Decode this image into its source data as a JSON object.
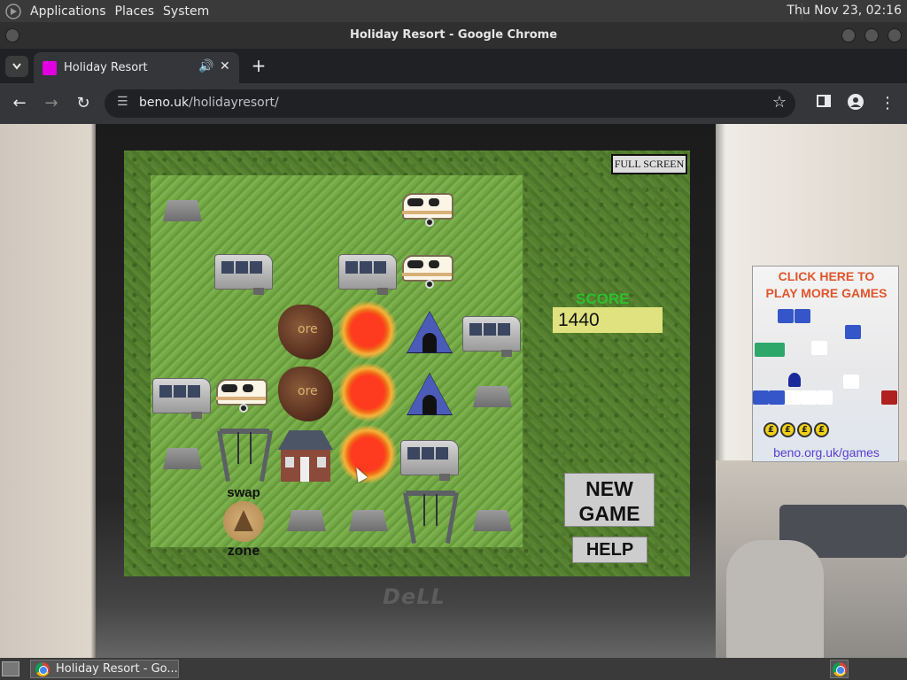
{
  "top_panel": {
    "menus": [
      "Applications",
      "Places",
      "System"
    ],
    "clock": "Thu Nov 23, 02:16"
  },
  "window": {
    "title": "Holiday Resort - Google Chrome"
  },
  "tab": {
    "title": "Holiday Resort"
  },
  "omnibox": {
    "host": "beno.uk",
    "path": "/holidayresort/"
  },
  "game": {
    "fullscreen_label": "FULL SCREEN",
    "score_label": "SCORE",
    "score": "1440",
    "new_game_label": "NEW\nGAME",
    "help_label": "HELP",
    "swap_label": "swap",
    "zone_label": "zone",
    "ore_text": "ore",
    "board": [
      [
        "rock",
        "empty",
        "empty",
        "empty",
        "caravan",
        "empty"
      ],
      [
        "empty",
        "static",
        "empty",
        "static",
        "caravan",
        "empty"
      ],
      [
        "empty",
        "empty",
        "ore",
        "sun",
        "tent",
        "static"
      ],
      [
        "static",
        "caravan",
        "ore",
        "sun",
        "tent",
        "rock"
      ],
      [
        "rock",
        "swing",
        "house",
        "sun",
        "static",
        "empty"
      ],
      [
        "empty",
        "empty",
        "rock",
        "rock",
        "swing",
        "rock"
      ]
    ]
  },
  "ad": {
    "title_line1": "CLICK HERE TO",
    "title_line2": "PLAY MORE GAMES",
    "coin_symbol": "£",
    "link_text": "beno.org.uk/games"
  },
  "taskbar": {
    "task_label": "Holiday Resort - Go..."
  }
}
